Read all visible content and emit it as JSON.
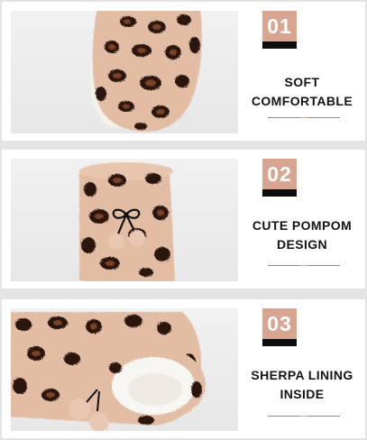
{
  "features": [
    {
      "number": "01",
      "caption_line1": "SOFT",
      "caption_line2": "COMFORTABLE",
      "image_subject": "leopard-print sherpa slipper sole view"
    },
    {
      "number": "02",
      "caption_line1": "CUTE POMPOM",
      "caption_line2": "DESIGN",
      "image_subject": "leopard-print sherpa slipper top with black bow and pompoms"
    },
    {
      "number": "03",
      "caption_line1": "SHERPA LINING",
      "caption_line2": "INSIDE",
      "image_subject": "leopard-print slipper opening showing white sherpa lining"
    }
  ],
  "colors": {
    "badge_fill": "#d8a591",
    "badge_bar": "#0d0d0d",
    "caption_text": "#141414",
    "slipper_fabric": "#e2bda4",
    "spot_dark": "#2a1711",
    "spot_mid": "#7c4226",
    "lining": "#f8f6f2"
  }
}
